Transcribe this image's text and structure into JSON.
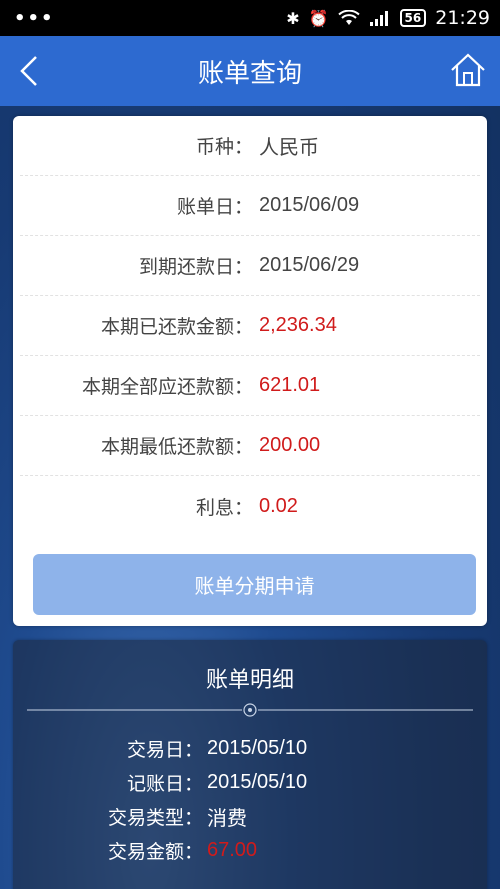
{
  "status_bar": {
    "notifications": "•••",
    "battery": "56",
    "time": "21:29"
  },
  "header": {
    "title": "账单查询"
  },
  "summary": [
    {
      "label": "币种：",
      "value": "人民币",
      "highlight": false
    },
    {
      "label": "账单日：",
      "value": "2015/06/09",
      "highlight": false
    },
    {
      "label": "到期还款日：",
      "value": "2015/06/29",
      "highlight": false
    },
    {
      "label": "本期已还款金额：",
      "value": "2,236.34",
      "highlight": true
    },
    {
      "label": "本期全部应还款额：",
      "value": "621.01",
      "highlight": true
    },
    {
      "label": "本期最低还款额：",
      "value": "200.00",
      "highlight": true
    },
    {
      "label": "利息：",
      "value": "0.02",
      "highlight": true
    }
  ],
  "apply_button": "账单分期申请",
  "detail": {
    "title": "账单明细",
    "rows": [
      {
        "label": "交易日：",
        "value": "2015/05/10",
        "highlight": false
      },
      {
        "label": "记账日：",
        "value": "2015/05/10",
        "highlight": false
      },
      {
        "label": "交易类型：",
        "value": "消费",
        "highlight": false
      },
      {
        "label": "交易金额：",
        "value": "67.00",
        "highlight": true
      }
    ]
  },
  "colors": {
    "header_bg": "#2d6ad0",
    "amount_red": "#d01b1b",
    "button_bg": "#8eb3ea"
  }
}
